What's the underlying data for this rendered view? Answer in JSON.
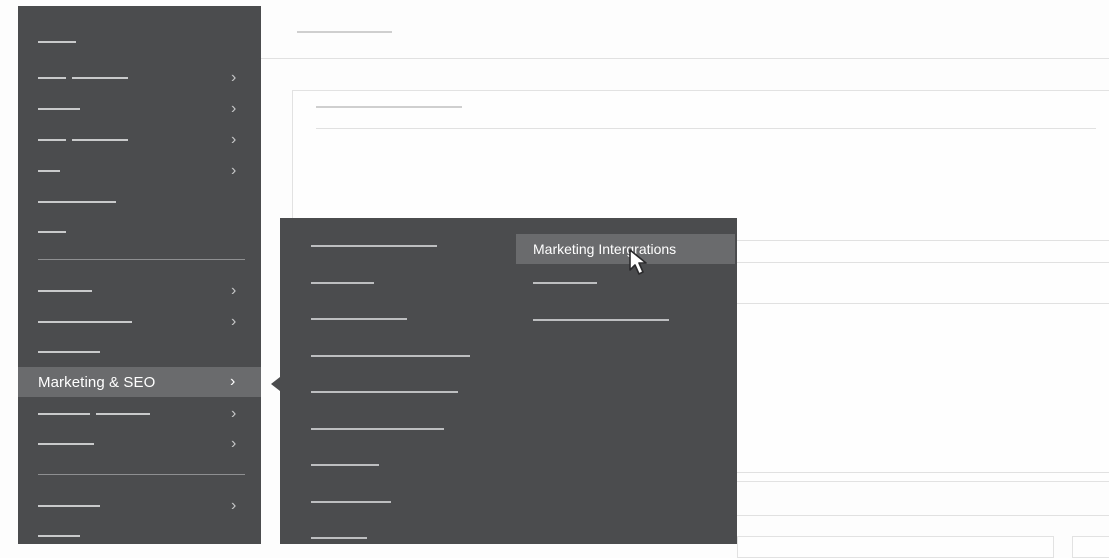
{
  "sidebar": {
    "active_item": {
      "label": "Marketing & SEO",
      "chevron": "›"
    },
    "chevron": "›"
  },
  "submenu": {
    "highlighted_item": {
      "label": "Marketing Intergrations"
    }
  },
  "icons": {
    "cursor": "mouse-pointer-icon",
    "chevron": "chevron-right-icon"
  },
  "colors": {
    "sidebar_bg": "#4b4c4e",
    "highlight_bg": "#6a6b6d",
    "placeholder_line": "#c9cacb",
    "page_bg": "#fdfdfd"
  }
}
